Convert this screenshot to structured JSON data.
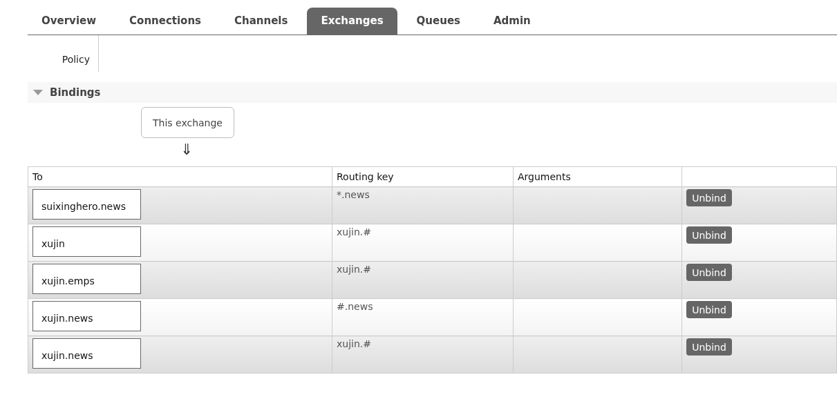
{
  "tabs": [
    {
      "label": "Overview",
      "selected": false
    },
    {
      "label": "Connections",
      "selected": false
    },
    {
      "label": "Channels",
      "selected": false
    },
    {
      "label": "Exchanges",
      "selected": true
    },
    {
      "label": "Queues",
      "selected": false
    },
    {
      "label": "Admin",
      "selected": false
    }
  ],
  "details": {
    "label": "Policy"
  },
  "bindings": {
    "title": "Bindings",
    "expanded": true,
    "source": "This exchange",
    "arrow": "⇓",
    "columns": [
      "To",
      "Routing key",
      "Arguments"
    ],
    "rows": [
      {
        "to": "suixinghero.news",
        "routing_key": "*.news",
        "action": "Unbind"
      },
      {
        "to": "xujin",
        "routing_key": "xujin.#",
        "action": "Unbind"
      },
      {
        "to": "xujin.emps",
        "routing_key": "xujin.#",
        "action": "Unbind"
      },
      {
        "to": "xujin.news",
        "routing_key": "#.news",
        "action": "Unbind"
      },
      {
        "to": "xujin.news",
        "routing_key": "xujin.#",
        "action": "Unbind"
      }
    ]
  }
}
